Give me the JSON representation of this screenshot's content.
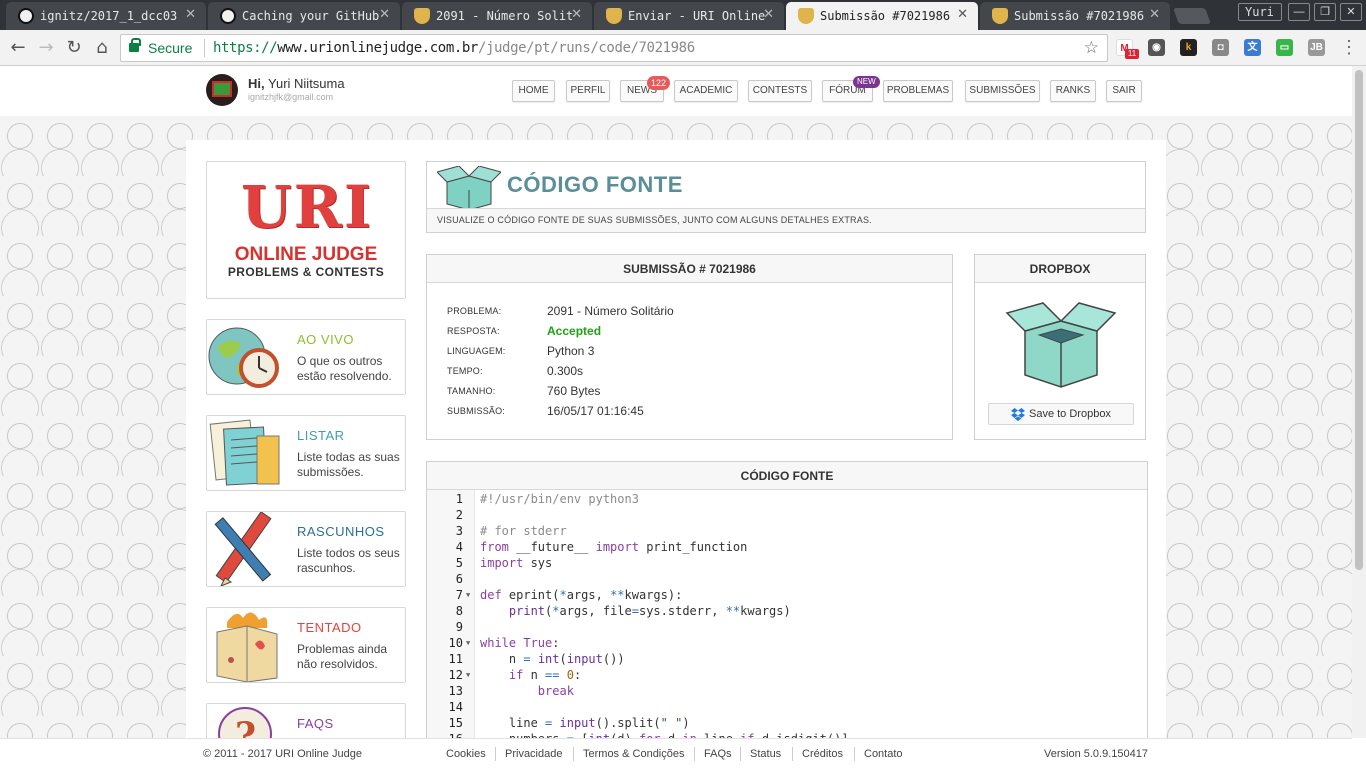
{
  "browser": {
    "tabs": [
      {
        "title": "ignitz/2017_1_dcc03",
        "icon": "github-icon"
      },
      {
        "title": "Caching your GitHub",
        "icon": "github-icon"
      },
      {
        "title": "2091 - Número Solit",
        "icon": "uri-trophy-icon"
      },
      {
        "title": "Enviar - URI Online",
        "icon": "uri-trophy-icon"
      },
      {
        "title": "Submissão #7021986",
        "icon": "uri-trophy-icon"
      },
      {
        "title": "Submissão #7021986",
        "icon": "uri-trophy-icon"
      }
    ],
    "profile_name": "Yuri",
    "secure_label": "Secure",
    "url_scheme": "https://",
    "url_host": "www.urionlinejudge.com.br",
    "url_path": "/judge/pt/runs/code/7021986",
    "gmail_count": "11"
  },
  "user": {
    "greeting": "Hi,",
    "name": "Yuri Niitsuma",
    "email": "ignitzhjfk@gmail.com"
  },
  "nav": {
    "items": [
      "HOME",
      "PERFIL",
      "NEWS",
      "ACADEMIC",
      "CONTESTS",
      "FÓRUM",
      "PROBLEMAS",
      "SUBMISSÕES",
      "RANKS",
      "SAIR"
    ],
    "news_badge": "122",
    "forum_badge": "NEW"
  },
  "logo": {
    "uri": "URI",
    "online_judge": "ONLINE JUDGE",
    "tagline": "PROBLEMS & CONTESTS"
  },
  "sidebar": [
    {
      "title": "AO VIVO",
      "desc": "O que os outros estão resolvendo.",
      "color": "#8cbf2e"
    },
    {
      "title": "LISTAR",
      "desc": "Liste todas as suas submissões.",
      "color": "#3f9bb5"
    },
    {
      "title": "RASCUNHOS",
      "desc": "Liste todos os seus rascunhos.",
      "color": "#2a6f9a"
    },
    {
      "title": "TENTADO",
      "desc": "Problemas ainda não resolvidos.",
      "color": "#e2443b"
    },
    {
      "title": "FAQS",
      "desc": "",
      "color": "#8a3fa0"
    }
  ],
  "page": {
    "title": "CÓDIGO FONTE",
    "subtitle": "VISUALIZE O CÓDIGO FONTE DE SUAS SUBMISSÕES, JUNTO COM ALGUNS DETALHES EXTRAS."
  },
  "submission": {
    "heading": "SUBMISSÃO # 7021986",
    "rows": [
      {
        "label": "PROBLEMA:",
        "value": "2091 - Número Solitário"
      },
      {
        "label": "RESPOSTA:",
        "value": "Accepted"
      },
      {
        "label": "LINGUAGEM:",
        "value": "Python 3"
      },
      {
        "label": "TEMPO:",
        "value": "0.300s"
      },
      {
        "label": "TAMANHO:",
        "value": "760 Bytes"
      },
      {
        "label": "SUBMISSÃO:",
        "value": "16/05/17 01:16:45"
      }
    ],
    "accepted_color": "#1fa214"
  },
  "dropbox": {
    "heading": "DROPBOX",
    "button": "Save to Dropbox"
  },
  "code": {
    "heading": "CÓDIGO FONTE",
    "lines": [
      "#!/usr/bin/env python3",
      "",
      "# for stderr",
      "from __future__ import print_function",
      "import sys",
      "",
      "def eprint(*args, **kwargs):",
      "    print(*args, file=sys.stderr, **kwargs)",
      "",
      "while True:",
      "    n = int(input())",
      "    if n == 0:",
      "        break",
      "",
      "    line = input().split(\" \")",
      "    numbers = [int(d) for d in line if d.isdigit()]"
    ],
    "folds": [
      7,
      10,
      12
    ]
  },
  "footer": {
    "copyright": "© 2011 - 2017 URI Online Judge",
    "links": [
      "Cookies",
      "Privacidade",
      "Termos & Condições",
      "FAQs",
      "Status",
      "Créditos",
      "Contato"
    ],
    "version": "Version 5.0.9.150417"
  }
}
